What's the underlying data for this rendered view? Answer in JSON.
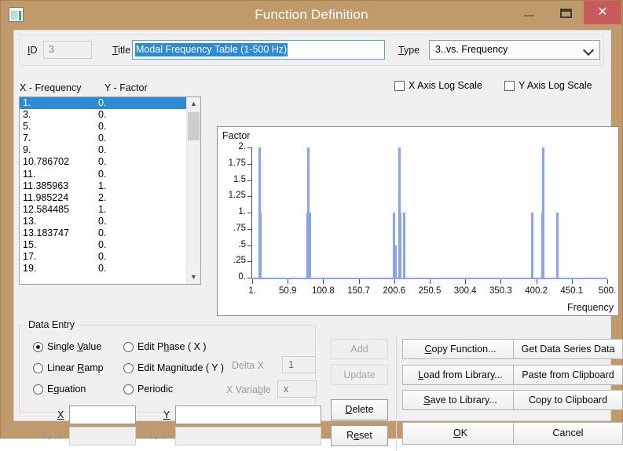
{
  "window": {
    "title": "Function Definition",
    "icon": "app-window-icon",
    "controls": {
      "minimize": "–",
      "maximize": "❐",
      "close": "✕"
    },
    "close_color": "#c75b5b",
    "frame_color": "#c19a6b"
  },
  "header": {
    "id_label": "ID",
    "id_value": "3",
    "title_label": "Title",
    "title_value": "Modal Frequency Table (1-500 Hz)",
    "type_label": "Type",
    "type_value": "3..vs. Frequency"
  },
  "table": {
    "header_x": "X - Frequency",
    "header_y": "Y - Factor",
    "rows": [
      {
        "x": "1.",
        "y": "0.",
        "selected": true
      },
      {
        "x": "3.",
        "y": "0.",
        "selected": false
      },
      {
        "x": "5.",
        "y": "0.",
        "selected": false
      },
      {
        "x": "7.",
        "y": "0.",
        "selected": false
      },
      {
        "x": "9.",
        "y": "0.",
        "selected": false
      },
      {
        "x": "10.786702",
        "y": "0.",
        "selected": false
      },
      {
        "x": "11.",
        "y": "0.",
        "selected": false
      },
      {
        "x": "11.385963",
        "y": "1.",
        "selected": false
      },
      {
        "x": "11.985224",
        "y": "2.",
        "selected": false
      },
      {
        "x": "12.584485",
        "y": "1.",
        "selected": false
      },
      {
        "x": "13.",
        "y": "0.",
        "selected": false
      },
      {
        "x": "13.183747",
        "y": "0.",
        "selected": false
      },
      {
        "x": "15.",
        "y": "0.",
        "selected": false
      },
      {
        "x": "17.",
        "y": "0.",
        "selected": false
      },
      {
        "x": "19.",
        "y": "0.",
        "selected": false
      }
    ],
    "scroll_up_icon": "chevron-up-icon",
    "scroll_down_icon": "chevron-down-icon"
  },
  "axis_options": {
    "x_log_label": "X Axis Log Scale",
    "x_log_checked": false,
    "y_log_label": "Y Axis Log Scale",
    "y_log_checked": false
  },
  "chart_data": {
    "type": "bar",
    "title": "Factor",
    "xlabel": "Frequency",
    "ylabel": "Factor",
    "xlim": [
      1,
      500
    ],
    "ylim": [
      0,
      2
    ],
    "grid": false,
    "legend": "none",
    "bar_color": "#8ba4e8",
    "xticks": [
      "1.",
      "50.9",
      "100.8",
      "150.7",
      "200.6",
      "250.5",
      "300.4",
      "350.3",
      "400.2",
      "450.1",
      "500."
    ],
    "xtick_values": [
      1,
      50.9,
      100.8,
      150.7,
      200.6,
      250.5,
      300.4,
      350.3,
      400.2,
      450.1,
      500
    ],
    "yticks": [
      "2.",
      "1.75",
      "1.5",
      "1.25",
      "1.",
      ".75",
      ".5",
      ".25",
      "0."
    ],
    "ytick_values": [
      2,
      1.75,
      1.5,
      1.25,
      1,
      0.75,
      0.5,
      0.25,
      0
    ],
    "x": [
      11.38,
      11.99,
      12.58,
      78.5,
      80.2,
      82.0,
      200.5,
      202.0,
      207.5,
      209.0,
      214.5,
      395.0,
      408.5,
      410.0,
      430.0
    ],
    "values": [
      1.0,
      2.0,
      1.0,
      1.0,
      2.0,
      1.0,
      1.0,
      0.5,
      2.0,
      1.0,
      1.0,
      1.0,
      1.0,
      2.0,
      1.0
    ]
  },
  "data_entry": {
    "group_label": "Data Entry",
    "modes": [
      {
        "label": "Single Value",
        "selected": true
      },
      {
        "label": "Linear Ramp",
        "selected": false
      },
      {
        "label": "Equation",
        "selected": false
      },
      {
        "label": "Edit Phase ( X )",
        "selected": false
      },
      {
        "label": "Edit Magnitude ( Y )",
        "selected": false
      },
      {
        "label": "Periodic",
        "selected": false
      }
    ],
    "delta_x_label": "Delta X",
    "delta_x_value": "1",
    "x_variable_label": "X Variable",
    "x_variable_value": "x",
    "x_label": "X",
    "x_value": "",
    "y_label": "Y",
    "y_value": "",
    "to_x_label": "To X",
    "to_x_value": "",
    "to_y_label": "To Y",
    "to_y_value": ""
  },
  "actions": {
    "add": "Add",
    "update": "Update",
    "delete": "Delete",
    "reset": "Reset",
    "copy_function": "Copy Function...",
    "load_from_library": "Load from Library...",
    "save_to_library": "Save to Library...",
    "ok": "OK",
    "get_data_series_data": "Get Data Series Data",
    "paste_from_clipboard": "Paste from Clipboard",
    "copy_to_clipboard": "Copy to Clipboard",
    "cancel": "Cancel"
  }
}
